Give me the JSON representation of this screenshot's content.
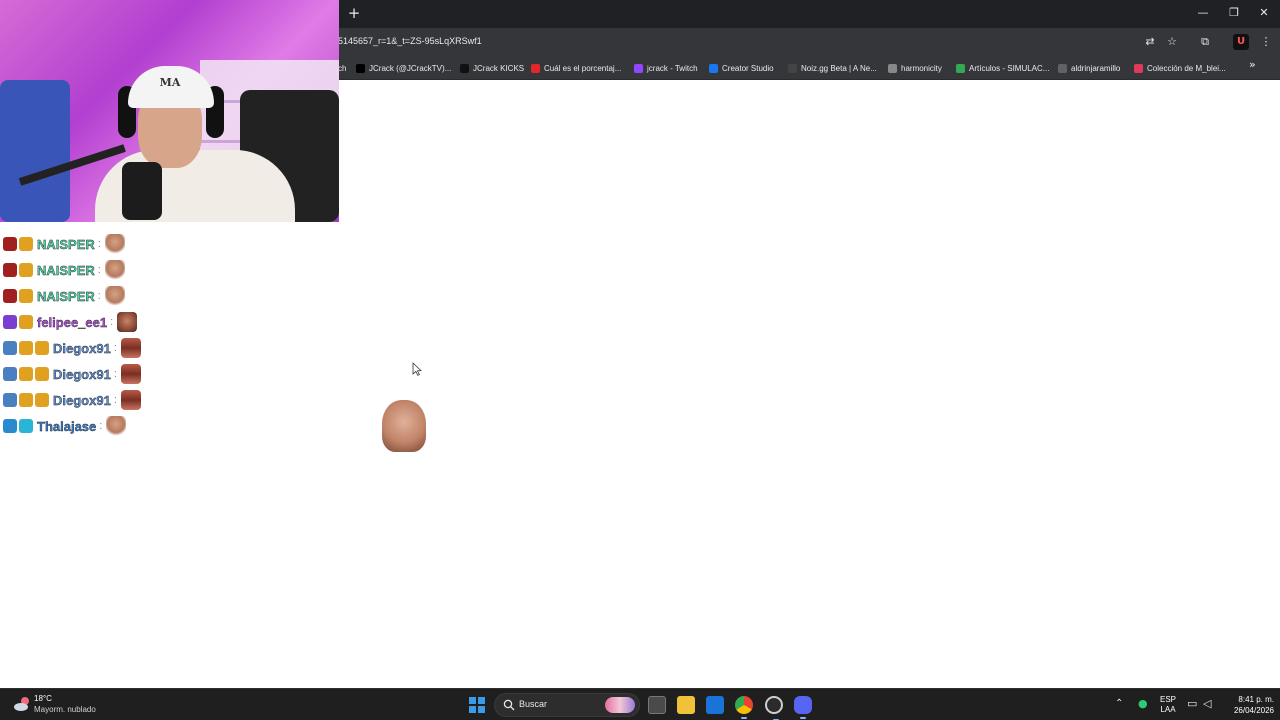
{
  "browser": {
    "window_controls": {
      "minimize": "—",
      "restore": "❐",
      "close": "✕"
    },
    "new_tab_label": "+",
    "address_bar": {
      "url": "5145657_r=1&_t=ZS-95sLqXRSwf1"
    },
    "toolbar_icons": [
      "translate-icon",
      "star-icon",
      "extensions-icon",
      "profile-extension-icon",
      "menu-icon"
    ],
    "bookmarks": [
      {
        "label": "ch",
        "icon": "twitch-icon",
        "color": "#9146ff"
      },
      {
        "label": "JCrack (@JCrackTV)...",
        "icon": "x-icon",
        "color": "#000000"
      },
      {
        "label": "JCrack KICKS",
        "icon": "shield-icon",
        "color": "#111111"
      },
      {
        "label": "Cuál es el porcentaj...",
        "icon": "s-icon",
        "color": "#e3262b"
      },
      {
        "label": "jcrack - Twitch",
        "icon": "twitch-icon",
        "color": "#9146ff"
      },
      {
        "label": "Creator Studio",
        "icon": "facebook-icon",
        "color": "#1877f2"
      },
      {
        "label": "Noiz.gg Beta | A Ne...",
        "icon": "noiz-icon",
        "color": "#444444"
      },
      {
        "label": "harmonicity",
        "icon": "doc-icon",
        "color": "#888888"
      },
      {
        "label": "Artículos - SIMULAC...",
        "icon": "drive-icon",
        "color": "#34a853"
      },
      {
        "label": "aldrinjaramillo",
        "icon": "globe-icon",
        "color": "#5f6368"
      },
      {
        "label": "Colección de M_blei...",
        "icon": "collection-icon",
        "color": "#e03a5b"
      }
    ],
    "bookmarks_more": "»"
  },
  "webcam": {
    "cap_logo": "MA"
  },
  "chat": {
    "messages": [
      {
        "username": "NAISPER",
        "color": "#4fd4a8",
        "badges": [
          {
            "icon": "shield-badge",
            "color": "#a02020"
          },
          {
            "icon": "crown-badge",
            "color": "#e0a020"
          }
        ],
        "separator": ":",
        "emote": "face1"
      },
      {
        "username": "NAISPER",
        "color": "#4fd4a8",
        "badges": [
          {
            "icon": "shield-badge",
            "color": "#a02020"
          },
          {
            "icon": "crown-badge",
            "color": "#e0a020"
          }
        ],
        "separator": ":",
        "emote": "face1"
      },
      {
        "username": "NAISPER",
        "color": "#4fd4a8",
        "badges": [
          {
            "icon": "shield-badge",
            "color": "#a02020"
          },
          {
            "icon": "crown-badge",
            "color": "#e0a020"
          }
        ],
        "separator": ":",
        "emote": "face1"
      },
      {
        "username": "felipee_ee1",
        "color": "#b44fe0",
        "badges": [
          {
            "icon": "shield-badge",
            "color": "#7a3fd0"
          },
          {
            "icon": "crown-badge",
            "color": "#e0a020"
          }
        ],
        "separator": ":",
        "emote": "face2"
      },
      {
        "username": "Diegox91",
        "color": "#5d8fd6",
        "badges": [
          {
            "icon": "gamer-badge",
            "color": "#4a7fc0"
          },
          {
            "icon": "coin-badge",
            "color": "#e0a020"
          },
          {
            "icon": "crown-badge",
            "color": "#e0a020"
          }
        ],
        "separator": ":",
        "emote": "face3"
      },
      {
        "username": "Diegox91",
        "color": "#5d8fd6",
        "badges": [
          {
            "icon": "gamer-badge",
            "color": "#4a7fc0"
          },
          {
            "icon": "coin-badge",
            "color": "#e0a020"
          },
          {
            "icon": "crown-badge",
            "color": "#e0a020"
          }
        ],
        "separator": ":",
        "emote": "face3"
      },
      {
        "username": "Diegox91",
        "color": "#5d8fd6",
        "badges": [
          {
            "icon": "gamer-badge",
            "color": "#4a7fc0"
          },
          {
            "icon": "coin-badge",
            "color": "#e0a020"
          },
          {
            "icon": "crown-badge",
            "color": "#e0a020"
          }
        ],
        "separator": ":",
        "emote": "face3"
      },
      {
        "username": "Thalajase",
        "color": "#3a7fd6",
        "badges": [
          {
            "icon": "cube-badge",
            "color": "#2a8ad0"
          },
          {
            "icon": "grid-badge",
            "color": "#29b6d6"
          }
        ],
        "separator": ":",
        "emote": "face1"
      }
    ]
  },
  "taskbar": {
    "weather": {
      "temp": "18°C",
      "desc": "Mayorm. nublado"
    },
    "search": {
      "placeholder": "Buscar"
    },
    "apps": [
      "start-icon",
      "search-icon",
      "task-view-icon",
      "file-explorer-icon",
      "outlook-icon",
      "chrome-icon",
      "obs-icon",
      "discord-icon"
    ],
    "tray": {
      "lang_top": "ESP",
      "lang_bottom": "LAA"
    },
    "clock": {
      "time": "8:41 p. m.",
      "date": "26/04/2026"
    }
  }
}
